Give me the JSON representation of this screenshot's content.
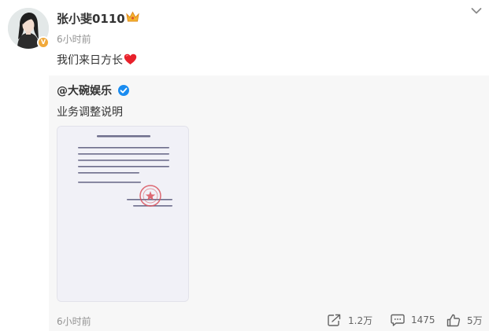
{
  "post": {
    "username": "张小斐0110",
    "time": "6小时前",
    "text": "我们来日方长",
    "avatar_icon": "avatar-woman-photo",
    "badge_icon": "verified-v-badge",
    "crown_icon": "vip-crown-icon",
    "heart_icon": "red-heart-emoji",
    "menu_icon": "chevron-down-icon"
  },
  "repost": {
    "author": "@大碗娱乐",
    "verified_icon": "blue-verified-icon",
    "text": "业务调整说明",
    "image_icon": "document-scan-image"
  },
  "footer": {
    "time": "6小时前",
    "repost_count": "1.2万",
    "comment_count": "1475",
    "like_count": "5万",
    "repost_icon": "share-icon",
    "comment_icon": "comment-icon",
    "like_icon": "thumbs-up-icon"
  },
  "colors": {
    "username": "#333333",
    "meta": "#939393",
    "repost_background": "#f7f7f7",
    "verified_blue": "#1a8cf0",
    "heart_red": "#e8212b",
    "badge_orange": "#f1a93b"
  }
}
